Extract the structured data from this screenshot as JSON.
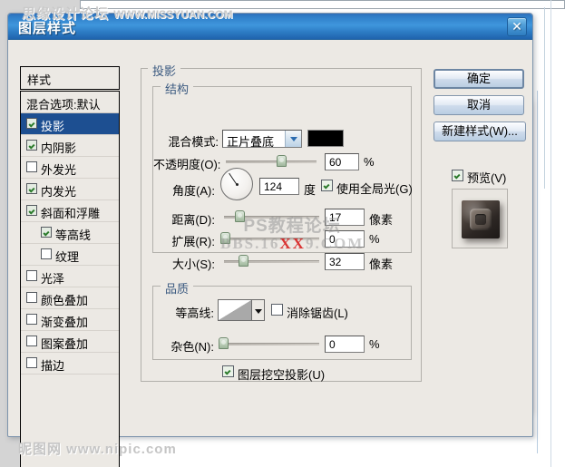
{
  "watermarks": {
    "top_cn": "思缘设计论坛",
    "top_en": "WWW.MISSYUAN.COM",
    "bottom": "昵图网  www.nipic.com",
    "center_line1": "PS教程论坛",
    "center_pre": "BBS.16",
    "center_red": "XX",
    "center_post": "9.COM"
  },
  "dialog": {
    "title": "图层样式",
    "close_icon": "close-icon"
  },
  "styles_panel": {
    "header": "样式",
    "blending_options": "混合选项:默认",
    "items": [
      {
        "label": "投影",
        "checked": true,
        "selected": true,
        "indent": false
      },
      {
        "label": "内阴影",
        "checked": true,
        "selected": false,
        "indent": false
      },
      {
        "label": "外发光",
        "checked": false,
        "selected": false,
        "indent": false
      },
      {
        "label": "内发光",
        "checked": true,
        "selected": false,
        "indent": false
      },
      {
        "label": "斜面和浮雕",
        "checked": true,
        "selected": false,
        "indent": false
      },
      {
        "label": "等高线",
        "checked": true,
        "selected": false,
        "indent": true
      },
      {
        "label": "纹理",
        "checked": false,
        "selected": false,
        "indent": true
      },
      {
        "label": "光泽",
        "checked": false,
        "selected": false,
        "indent": false
      },
      {
        "label": "颜色叠加",
        "checked": false,
        "selected": false,
        "indent": false
      },
      {
        "label": "渐变叠加",
        "checked": false,
        "selected": false,
        "indent": false
      },
      {
        "label": "图案叠加",
        "checked": false,
        "selected": false,
        "indent": false
      },
      {
        "label": "描边",
        "checked": false,
        "selected": false,
        "indent": false
      }
    ]
  },
  "main": {
    "group_title": "投影",
    "structure": {
      "title": "结构",
      "blend_mode_label": "混合模式:",
      "blend_mode_value": "正片叠底",
      "color_swatch": "#000000",
      "opacity_label": "不透明度(O):",
      "opacity_value": "60",
      "opacity_unit": "%",
      "angle_label": "角度(A):",
      "angle_value": "124",
      "angle_unit": "度",
      "global_light_label": "使用全局光(G)",
      "global_light_checked": true,
      "distance_label": "距离(D):",
      "distance_value": "17",
      "distance_unit": "像素",
      "spread_label": "扩展(R):",
      "spread_value": "0",
      "spread_unit": "%",
      "size_label": "大小(S):",
      "size_value": "32",
      "size_unit": "像素"
    },
    "quality": {
      "title": "品质",
      "contour_label": "等高线:",
      "antialias_label": "消除锯齿(L)",
      "antialias_checked": false,
      "noise_label": "杂色(N):",
      "noise_value": "0",
      "noise_unit": "%"
    },
    "knockout_label": "图层挖空投影(U)",
    "knockout_checked": true
  },
  "buttons": {
    "ok": "确定",
    "cancel": "取消",
    "new_style": "新建样式(W)...",
    "preview_label": "预览(V)",
    "preview_checked": true
  }
}
